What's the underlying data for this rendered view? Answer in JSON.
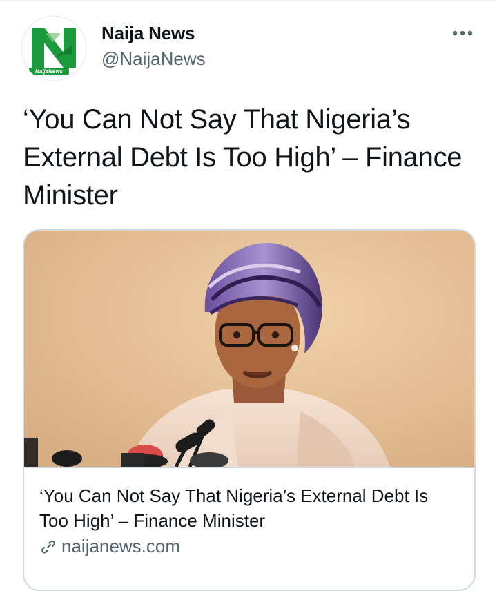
{
  "account": {
    "display_name": "Naija News",
    "handle": "@NaijaNews",
    "avatar_icon": "naija-news-logo",
    "avatar_logo_text": "NaijaNews",
    "brand_green": "#1a9a3c"
  },
  "tweet": {
    "text": "‘You Can Not Say That Nigeria’s External Debt Is Too High’ – Finance Minister"
  },
  "menu": {
    "icon": "more-horizontal-icon"
  },
  "link_card": {
    "image_icon": "photo",
    "title": "‘You Can Not Say That Nigeria’s External Debt Is Too High’ – Finance Minister",
    "domain_icon": "link-icon",
    "domain": "naijanews.com"
  },
  "colors": {
    "text_primary": "#0f1419",
    "text_secondary": "#536471",
    "border": "#cfd9de"
  }
}
